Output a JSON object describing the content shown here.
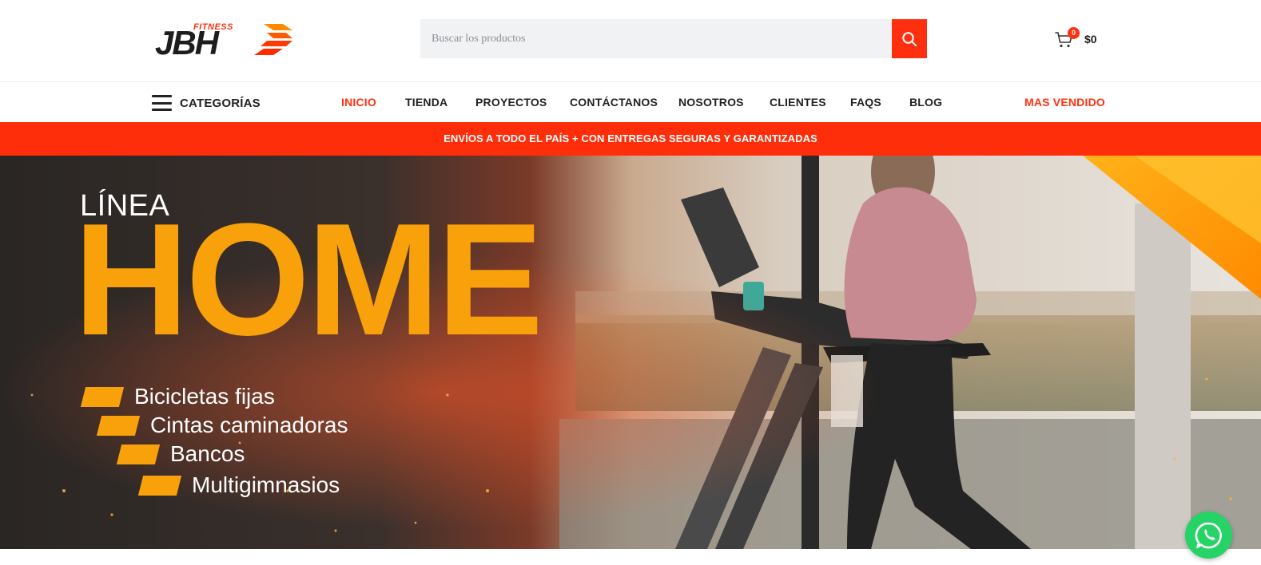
{
  "brand": {
    "logo_main": "JBH",
    "logo_sub": "FITNESS",
    "primary_color": "#ff3010",
    "accent_color": "#f9a10a"
  },
  "search": {
    "placeholder": "Buscar los productos",
    "button_icon": "search-icon"
  },
  "cart": {
    "icon": "cart-icon",
    "count": "0",
    "total": "$0"
  },
  "nav": {
    "categories_label": "CATEGORÍAS",
    "items": [
      {
        "label": "INICIO",
        "active": true
      },
      {
        "label": "TIENDA"
      },
      {
        "label": "PROYECTOS"
      },
      {
        "label": "CONTÁCTANOS"
      },
      {
        "label": "NOSOTROS"
      },
      {
        "label": "CLIENTES"
      },
      {
        "label": "FAQS"
      },
      {
        "label": "BLOG"
      }
    ],
    "best_seller": "MAS VENDIDO"
  },
  "promo": {
    "text": "ENVÍOS A TODO EL PAÍS + CON ENTREGAS SEGURAS Y GARANTIZADAS"
  },
  "hero": {
    "pre_title": "LÍNEA",
    "title": "HOME",
    "items": [
      "Bicicletas fijas",
      "Cintas caminadoras",
      "Bancos",
      "Multigimnasios"
    ]
  },
  "whatsapp": {
    "icon": "whatsapp-icon"
  }
}
